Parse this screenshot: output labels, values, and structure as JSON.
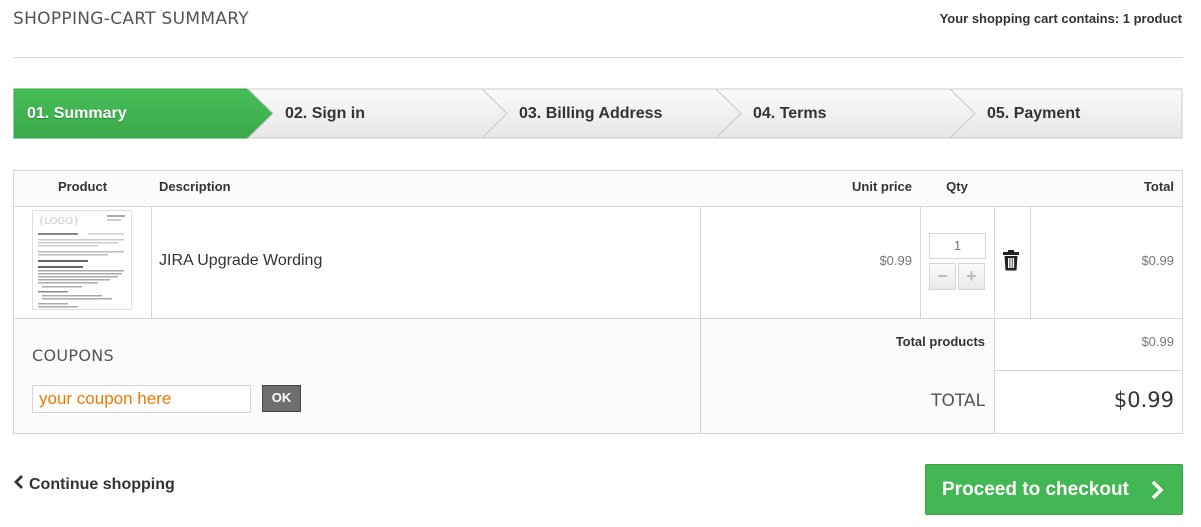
{
  "header": {
    "title": "SHOPPING-CART SUMMARY",
    "cart_count": "Your shopping cart contains: 1 product"
  },
  "steps": [
    {
      "label": "01. Summary",
      "active": true
    },
    {
      "label": "02. Sign in",
      "active": false
    },
    {
      "label": "03. Billing Address",
      "active": false
    },
    {
      "label": "04. Terms",
      "active": false
    },
    {
      "label": "05. Payment",
      "active": false
    }
  ],
  "table": {
    "headers": {
      "product": "Product",
      "description": "Description",
      "unit_price": "Unit price",
      "qty": "Qty",
      "total": "Total"
    },
    "rows": [
      {
        "description": "JIRA Upgrade Wording",
        "unit_price": "$0.99",
        "qty": "1",
        "total": "$0.99",
        "thumbnail_logo": "{LOGO}"
      }
    ]
  },
  "totals": {
    "products_label": "Total products",
    "products_value": "$0.99",
    "total_label": "TOTAL",
    "total_value": "$0.99"
  },
  "coupons": {
    "title": "COUPONS",
    "placeholder": "your coupon here",
    "ok_label": "OK"
  },
  "footer": {
    "continue_label": "Continue shopping",
    "checkout_label": "Proceed to checkout"
  },
  "colors": {
    "accent_green": "#43b754",
    "coupon_text": "#f07800"
  },
  "icons": {
    "delete": "trash-icon",
    "decrease": "minus-icon",
    "increase": "plus-icon",
    "back": "chevron-left-icon",
    "forward": "chevron-right-icon"
  }
}
